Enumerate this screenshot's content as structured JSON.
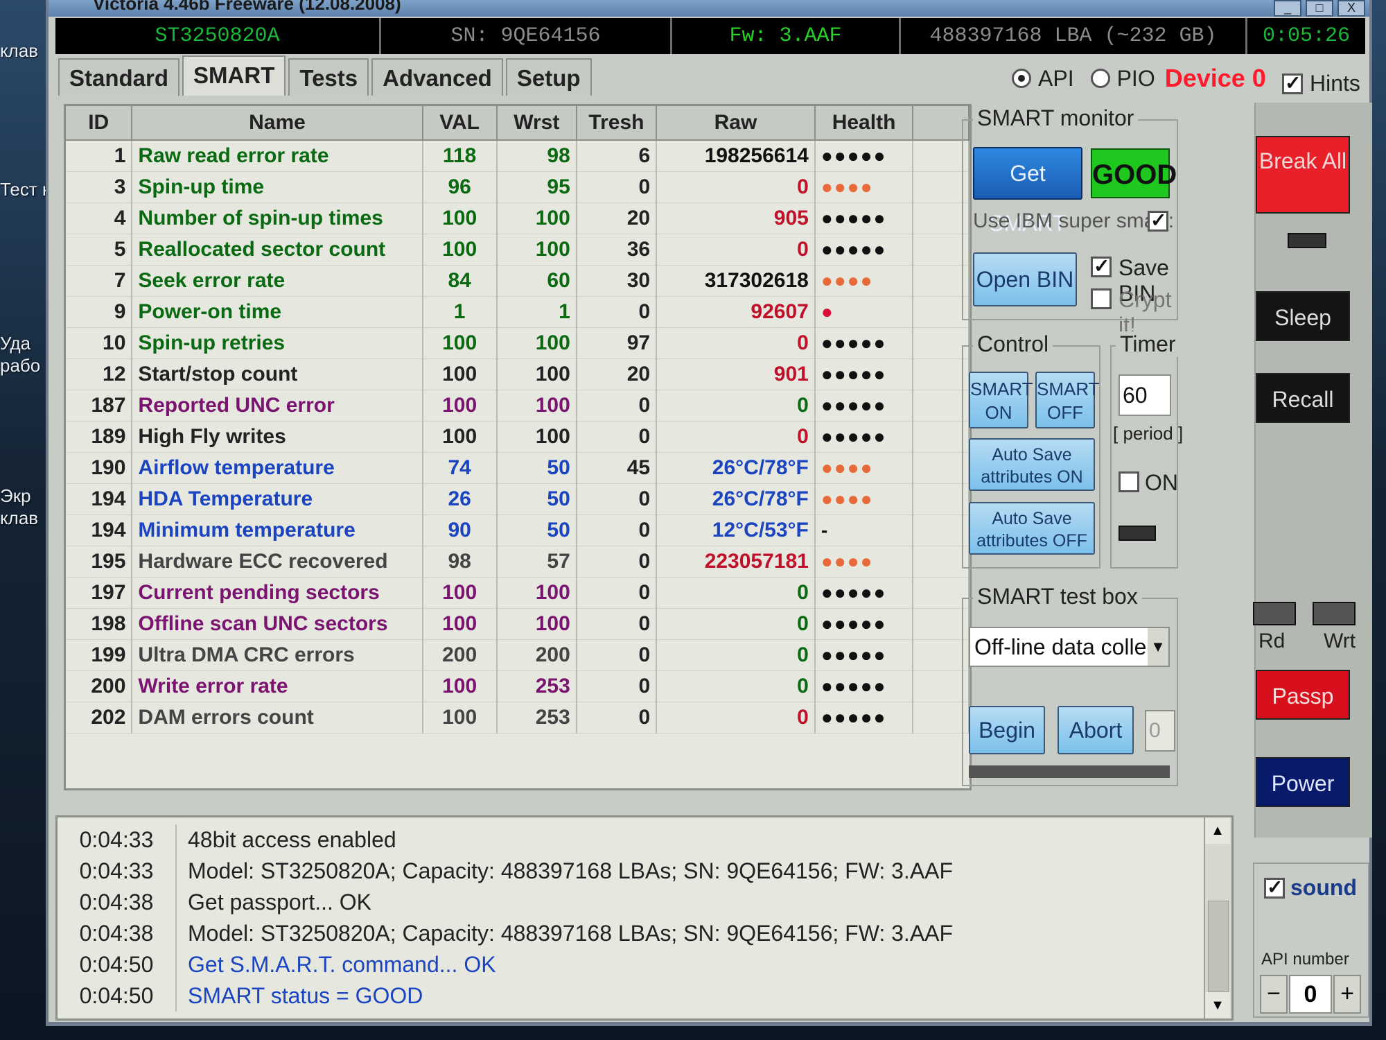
{
  "desktop_labels": [
    "клав",
    "Тест н",
    "Уда",
    "рабо",
    "Экр",
    "клав"
  ],
  "window": {
    "title": "Victoria 4.46b Freeware (12.08.2008)",
    "buttons": [
      "_",
      "□",
      "X"
    ]
  },
  "info": {
    "model": "ST3250820A",
    "serial": "SN: 9QE64156",
    "firmware": "Fw: 3.AAF",
    "capacity": "488397168 LBA (~232 GB)",
    "timer": "0:05:26"
  },
  "tabs": [
    "Standard",
    "SMART",
    "Tests",
    "Advanced",
    "Setup"
  ],
  "mode": {
    "api": "API",
    "pio": "PIO",
    "device": "Device 0"
  },
  "hints": "Hints",
  "table": {
    "headers": [
      "ID",
      "Name",
      "VAL",
      "Wrst",
      "Tresh",
      "Raw",
      "Health"
    ],
    "rows": [
      {
        "id": "1",
        "name": "Raw read error rate",
        "val": "118",
        "wrst": "98",
        "tresh": "6",
        "raw": "198256614",
        "health": "●●●●●",
        "color": "#0a6a12",
        "rawcolor": "#111",
        "hcolor": "#111"
      },
      {
        "id": "3",
        "name": "Spin-up time",
        "val": "96",
        "wrst": "95",
        "tresh": "0",
        "raw": "0",
        "health": "●●●●",
        "color": "#0a6a12",
        "rawcolor": "#c0112a",
        "hcolor": "#e86a3a"
      },
      {
        "id": "4",
        "name": "Number of spin-up times",
        "val": "100",
        "wrst": "100",
        "tresh": "20",
        "raw": "905",
        "health": "●●●●●",
        "color": "#0a6a12",
        "rawcolor": "#c0112a",
        "hcolor": "#111"
      },
      {
        "id": "5",
        "name": "Reallocated sector count",
        "val": "100",
        "wrst": "100",
        "tresh": "36",
        "raw": "0",
        "health": "●●●●●",
        "color": "#0a6a12",
        "rawcolor": "#c0112a",
        "hcolor": "#111"
      },
      {
        "id": "7",
        "name": "Seek error rate",
        "val": "84",
        "wrst": "60",
        "tresh": "30",
        "raw": "317302618",
        "health": "●●●●",
        "color": "#0a6a12",
        "rawcolor": "#111",
        "hcolor": "#e86a3a"
      },
      {
        "id": "9",
        "name": "Power-on time",
        "val": "1",
        "wrst": "1",
        "tresh": "0",
        "raw": "92607",
        "health": "●",
        "color": "#0a6a12",
        "rawcolor": "#c0112a",
        "hcolor": "#d8103a"
      },
      {
        "id": "10",
        "name": "Spin-up retries",
        "val": "100",
        "wrst": "100",
        "tresh": "97",
        "raw": "0",
        "health": "●●●●●",
        "color": "#0a6a12",
        "rawcolor": "#c0112a",
        "hcolor": "#111"
      },
      {
        "id": "12",
        "name": "Start/stop count",
        "val": "100",
        "wrst": "100",
        "tresh": "20",
        "raw": "901",
        "health": "●●●●●",
        "color": "#222",
        "rawcolor": "#c0112a",
        "hcolor": "#111"
      },
      {
        "id": "187",
        "name": "Reported UNC error",
        "val": "100",
        "wrst": "100",
        "tresh": "0",
        "raw": "0",
        "health": "●●●●●",
        "color": "#7a1470",
        "rawcolor": "#0a6a12",
        "hcolor": "#111"
      },
      {
        "id": "189",
        "name": "High Fly writes",
        "val": "100",
        "wrst": "100",
        "tresh": "0",
        "raw": "0",
        "health": "●●●●●",
        "color": "#222",
        "rawcolor": "#c0112a",
        "hcolor": "#111"
      },
      {
        "id": "190",
        "name": "Airflow temperature",
        "val": "74",
        "wrst": "50",
        "tresh": "45",
        "raw": "26°C/78°F",
        "health": "●●●●",
        "color": "#1a44c0",
        "rawcolor": "#1a44c0",
        "hcolor": "#e86a3a"
      },
      {
        "id": "194",
        "name": "HDA Temperature",
        "val": "26",
        "wrst": "50",
        "tresh": "0",
        "raw": "26°C/78°F",
        "health": "●●●●",
        "color": "#1a44c0",
        "rawcolor": "#1a44c0",
        "hcolor": "#e86a3a"
      },
      {
        "id": "194",
        "name": "Minimum temperature",
        "val": "90",
        "wrst": "50",
        "tresh": "0",
        "raw": "12°C/53°F",
        "health": "-",
        "color": "#1a44c0",
        "rawcolor": "#1a44c0",
        "hcolor": "#111"
      },
      {
        "id": "195",
        "name": "Hardware ECC recovered",
        "val": "98",
        "wrst": "57",
        "tresh": "0",
        "raw": "223057181",
        "health": "●●●●",
        "color": "#444",
        "rawcolor": "#c0112a",
        "hcolor": "#e86a3a"
      },
      {
        "id": "197",
        "name": "Current pending sectors",
        "val": "100",
        "wrst": "100",
        "tresh": "0",
        "raw": "0",
        "health": "●●●●●",
        "color": "#7a1470",
        "rawcolor": "#0a6a12",
        "hcolor": "#111"
      },
      {
        "id": "198",
        "name": "Offline scan UNC sectors",
        "val": "100",
        "wrst": "100",
        "tresh": "0",
        "raw": "0",
        "health": "●●●●●",
        "color": "#7a1470",
        "rawcolor": "#0a6a12",
        "hcolor": "#111"
      },
      {
        "id": "199",
        "name": "Ultra DMA CRC errors",
        "val": "200",
        "wrst": "200",
        "tresh": "0",
        "raw": "0",
        "health": "●●●●●",
        "color": "#444",
        "rawcolor": "#0a6a12",
        "hcolor": "#111"
      },
      {
        "id": "200",
        "name": "Write error rate",
        "val": "100",
        "wrst": "253",
        "tresh": "0",
        "raw": "0",
        "health": "●●●●●",
        "color": "#7a1470",
        "rawcolor": "#0a6a12",
        "hcolor": "#111"
      },
      {
        "id": "202",
        "name": "DAM errors count",
        "val": "100",
        "wrst": "253",
        "tresh": "0",
        "raw": "0",
        "health": "●●●●●",
        "color": "#444",
        "rawcolor": "#c0112a",
        "hcolor": "#111"
      }
    ]
  },
  "smart_monitor": {
    "title": "SMART monitor",
    "get_smart": "Get SMART",
    "status": "GOOD",
    "ibm_label": "Use IBM super smart:",
    "open_bin": "Open BIN",
    "save_bin": "Save BIN",
    "crypt": "Crypt it!"
  },
  "control": {
    "title": "Control",
    "smart_on": "SMART ON",
    "smart_off": "SMART OFF",
    "auto_on": "Auto Save attributes ON",
    "auto_off": "Auto Save attributes OFF"
  },
  "timer": {
    "title": "Timer",
    "value": "60",
    "period": "[ period ]",
    "on": "ON"
  },
  "test_box": {
    "title": "SMART test box",
    "selected": "Off-line data collect",
    "begin": "Begin",
    "abort": "Abort",
    "value": "0"
  },
  "side": {
    "break": "Break All",
    "sleep": "Sleep",
    "recall": "Recall",
    "rd": "Rd",
    "wrt": "Wrt",
    "passp": "Passp",
    "power": "Power",
    "sound": "sound",
    "api_number": "API number",
    "api_value": "0",
    "minus": "−",
    "plus": "+"
  },
  "log": [
    {
      "time": "0:04:33",
      "msg": "48bit access enabled",
      "color": "#222"
    },
    {
      "time": "0:04:33",
      "msg": "Model: ST3250820A; Capacity: 488397168 LBAs; SN: 9QE64156; FW: 3.AAF",
      "color": "#222"
    },
    {
      "time": "0:04:38",
      "msg": "Get passport... OK",
      "color": "#222"
    },
    {
      "time": "0:04:38",
      "msg": "Model: ST3250820A; Capacity: 488397168 LBAs; SN: 9QE64156; FW: 3.AAF",
      "color": "#222"
    },
    {
      "time": "0:04:50",
      "msg": "Get S.M.A.R.T. command... OK",
      "color": "#1a44c0"
    },
    {
      "time": "0:04:50",
      "msg": "SMART status = GOOD",
      "color": "#1a44c0"
    }
  ],
  "colors": {
    "ok_green": "#1ec81e",
    "break_red": "#e8202a",
    "passp_red": "#d8101e",
    "power_blue": "#0a1a6a"
  }
}
